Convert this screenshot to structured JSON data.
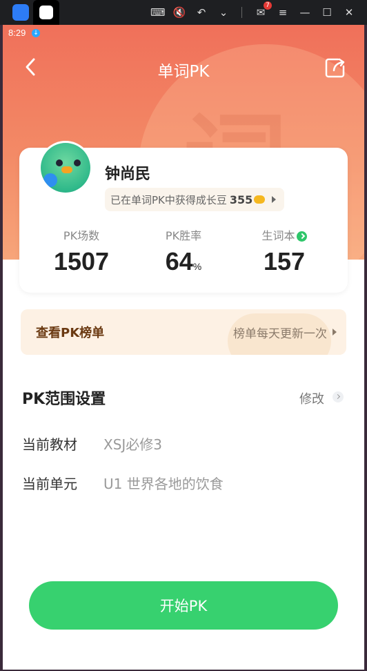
{
  "status": {
    "time": "8:29"
  },
  "emulator": {
    "mail_badge": "7"
  },
  "header": {
    "title": "单词PK"
  },
  "hero": {
    "glyph": "词"
  },
  "profile": {
    "name": "钟尚民",
    "bean_text": "已在单词PK中获得成长豆",
    "bean_count": "355"
  },
  "stats": [
    {
      "label": "PK场数",
      "value": "1507",
      "unit": ""
    },
    {
      "label": "PK胜率",
      "value": "64",
      "unit": "%"
    },
    {
      "label": "生词本",
      "value": "157",
      "unit": ""
    }
  ],
  "leaderboard": {
    "title": "查看PK榜单",
    "hint": "榜单每天更新一次"
  },
  "range": {
    "title": "PK范围设置",
    "edit_label": "修改",
    "rows": [
      {
        "label": "当前教材",
        "value": "XSJ必修3"
      },
      {
        "label": "当前单元",
        "value": "U1 世界各地的饮食"
      }
    ]
  },
  "start_button": "开始PK",
  "colors": {
    "hero": "#f0705a",
    "accent_green": "#37d16f",
    "banner_bg": "#fdf1e4",
    "banner_title": "#6b3a12"
  },
  "icons": {
    "back": "chevron-left-icon",
    "share": "share-icon",
    "coin": "coin-icon",
    "check": "check-circle-icon"
  }
}
